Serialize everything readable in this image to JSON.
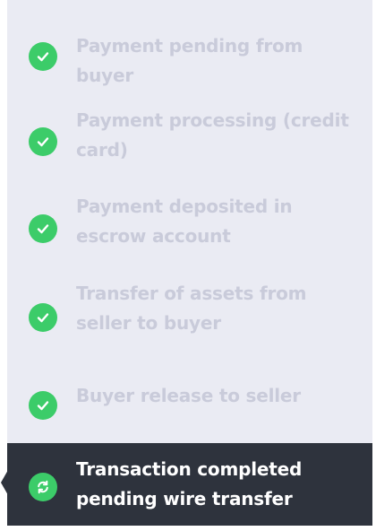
{
  "steps": [
    {
      "label": "Payment pending from buyer",
      "status": "complete",
      "icon": "check-icon"
    },
    {
      "label": "Payment processing (credit card)",
      "status": "complete",
      "icon": "check-icon"
    },
    {
      "label": "Payment deposited in escrow account",
      "status": "complete",
      "icon": "check-icon"
    },
    {
      "label": "Transfer of assets from seller to buyer",
      "status": "complete",
      "icon": "check-icon"
    },
    {
      "label": "Buyer release to seller",
      "status": "complete",
      "icon": "check-icon"
    },
    {
      "label": "Transaction completed pending wire transfer",
      "status": "in-progress",
      "icon": "refresh-icon"
    }
  ],
  "colors": {
    "panel_bg": "#eaebf3",
    "complete_text": "#c9cbda",
    "active_bg": "#2e333d",
    "active_text": "#ffffff",
    "icon_green": "#3ccc69"
  }
}
